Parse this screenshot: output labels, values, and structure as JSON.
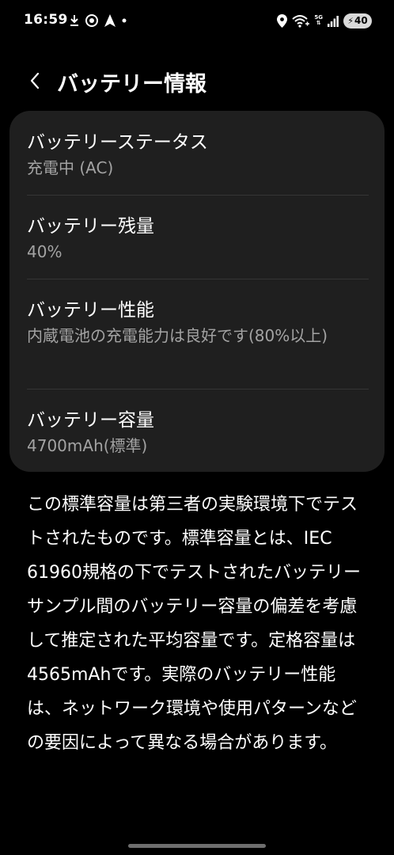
{
  "status_bar": {
    "time": "16:59",
    "battery_level": "40",
    "network_label_top": "5G",
    "left_icons": [
      "download-icon",
      "target-app-icon",
      "navigation-arrow-icon",
      "notification-dot-icon"
    ],
    "right_icons": [
      "location-pin-icon",
      "wifi-icon",
      "mobile-data-icon",
      "signal-icon",
      "charging-battery-icon"
    ]
  },
  "header": {
    "back_icon": "chevron-left-icon",
    "title": "バッテリー情報"
  },
  "card": {
    "items": [
      {
        "title": "バッテリーステータス",
        "value": "充電中 (AC)"
      },
      {
        "title": "バッテリー残量",
        "value": "40%"
      },
      {
        "title": "バッテリー性能",
        "value": "内蔵電池の充電能力は良好です(80%以上)"
      },
      {
        "title": "バッテリー容量",
        "value": "4700mAh(標準)"
      }
    ]
  },
  "description": "この標準容量は第三者の実験環境下でテストされたものです。標準容量とは、IEC 61960規格の下でテストされたバッテリーサンプル間のバッテリー容量の偏差を考慮して推定された平均容量です。定格容量は4565mAhです。実際のバッテリー性能は、ネットワーク環境や使用パターンなどの要因によって異なる場合があります。",
  "colors": {
    "background": "#000000",
    "card": "#1f1f1f",
    "secondary_text": "#a3a3a3"
  }
}
